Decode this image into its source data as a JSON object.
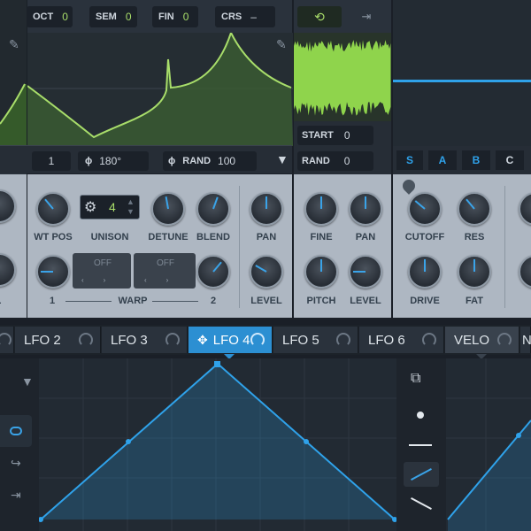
{
  "osc": {
    "oct": {
      "label": "OCT",
      "value": "0"
    },
    "sem": {
      "label": "SEM",
      "value": "0"
    },
    "fin": {
      "label": "FIN",
      "value": "0"
    },
    "crs": {
      "label": "CRS",
      "value": "–"
    },
    "unison_value": "4",
    "left_partial_value": "1",
    "phase_value": "180°",
    "rand_label": "RAND",
    "rand_value": "100",
    "knobs": {
      "wt_pos": "WT POS",
      "unison": "UNISON",
      "detune": "DETUNE",
      "blend": "BLEND",
      "pan": "PAN",
      "level": "LEVEL",
      "warp": "WARP",
      "warp_off_1": "OFF",
      "warp_off_2": "OFF",
      "warp_1": "1",
      "warp_2": "2",
      "left_an": "AN",
      "left_evel": "EVEL"
    }
  },
  "noise": {
    "start_label": "START",
    "start_value": "0",
    "rand_label": "RAND",
    "rand_value": "0",
    "fine": "FINE",
    "pan": "PAN",
    "pitch": "PITCH",
    "level": "LEVEL"
  },
  "filter": {
    "tabs": [
      "S",
      "A",
      "B",
      "C"
    ],
    "cutoff": "CUTOFF",
    "res": "RES",
    "drive": "DRIVE",
    "fat": "FAT"
  },
  "lfo_tabs": [
    {
      "label": "LFO 2"
    },
    {
      "label": "LFO 3"
    },
    {
      "label": "LFO 4"
    },
    {
      "label": "LFO 5"
    },
    {
      "label": "LFO 6"
    }
  ],
  "velo_tab": "VELO",
  "colors": {
    "accent": "#2c8fd2",
    "wave": "#a8dd6a",
    "lfo_line": "#2fa2ea",
    "panel": "#aeb7c2"
  }
}
